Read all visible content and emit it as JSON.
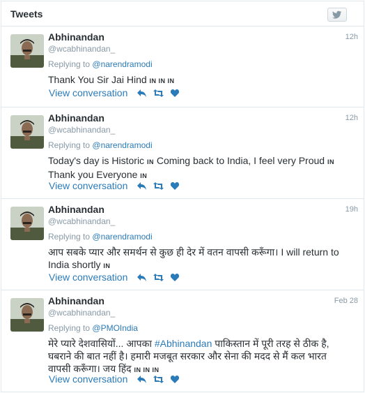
{
  "header": {
    "title": "Tweets",
    "icon": "twitter-bird-icon"
  },
  "tweets": [
    {
      "name": "Abhinandan",
      "handle": "@wcabhinandan_",
      "time": "12h",
      "replying_to": "Replying to",
      "mention": "@narendramodi",
      "text_parts": [
        "Thank You Sir Jai Hind ",
        "IN IN IN"
      ],
      "view_conversation": "View conversation"
    },
    {
      "name": "Abhinandan",
      "handle": "@wcabhinandan_",
      "time": "12h",
      "replying_to": "Replying to",
      "mention": "@narendramodi",
      "text_line1": "Today's day is Historic ",
      "text_flag1": "IN",
      "text_line1b": " Coming back to India, I feel very Proud ",
      "text_flag2": "IN",
      "text_line2": "Thank you Everyone ",
      "text_flag3": "IN",
      "view_conversation": "View conversation"
    },
    {
      "name": "Abhinandan",
      "handle": "@wcabhinandan_",
      "time": "19h",
      "replying_to": "Replying to",
      "mention": "@narendramodi",
      "text_line1": "आप सबके प्यार और समर्थन से कुछ ही देर में वतन वापसी करूँगा। I will return to",
      "text_line2": "India shortly ",
      "text_flag": "IN",
      "view_conversation": "View conversation"
    },
    {
      "name": "Abhinandan",
      "handle": "@wcabhinandan_",
      "time": "Feb 28",
      "replying_to": "Replying to",
      "mention": "@PMOIndia",
      "text_a": "मेरे प्यारे देशवासियों... आपका ",
      "hashtag": "#Abhinandan",
      "text_b": " पाकिस्तान में पूरी तरह से ठीक है,",
      "text_line2": "घबराने की बात नहीं है। हमारी मजबूत सरकार और सेना की मदद से मैं कल भारत",
      "text_line3": "वापसी करूँगा। जय हिंद ",
      "text_flags": "IN IN IN",
      "view_conversation": "View conversation"
    }
  ],
  "colors": {
    "link": "#2b7bb9",
    "muted": "#8899a6",
    "text": "#292f33",
    "border": "#e1e8ed"
  }
}
